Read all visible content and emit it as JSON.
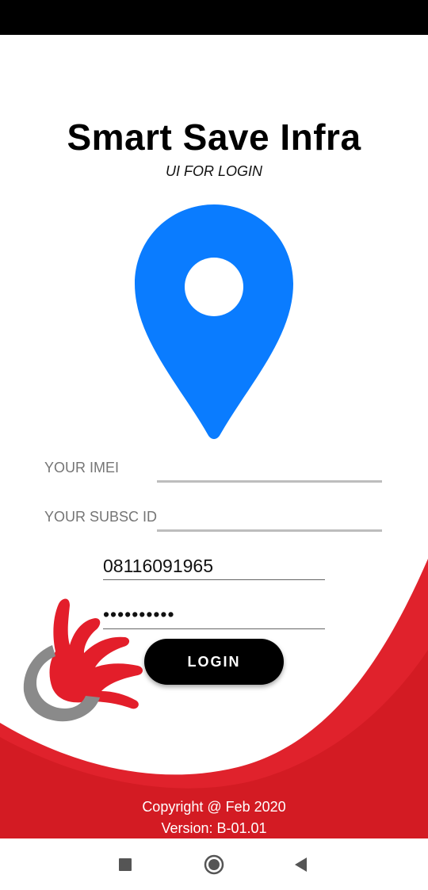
{
  "app": {
    "title": "Smart Save Infra",
    "subtitle": "UI FOR LOGIN"
  },
  "form": {
    "imei_label": "YOUR IMEI",
    "imei_value": "",
    "subsc_label": "YOUR SUBSC ID",
    "subsc_value": "",
    "phone_value": "08116091965",
    "password_value": "••••••••••",
    "login_label": "LOGIN"
  },
  "footer": {
    "copyright": "Copyright @ Feb 2020",
    "version": "Version: B-01.01"
  },
  "icons": {
    "pin": "location-pin-icon",
    "logo": "company-logo-icon",
    "nav_recent": "square-icon",
    "nav_home": "circle-icon",
    "nav_back": "triangle-back-icon"
  },
  "colors": {
    "pin_blue": "#0a7cff",
    "brand_red": "#e31e2a",
    "logo_gray": "#8a8a8a",
    "button_black": "#000000"
  }
}
